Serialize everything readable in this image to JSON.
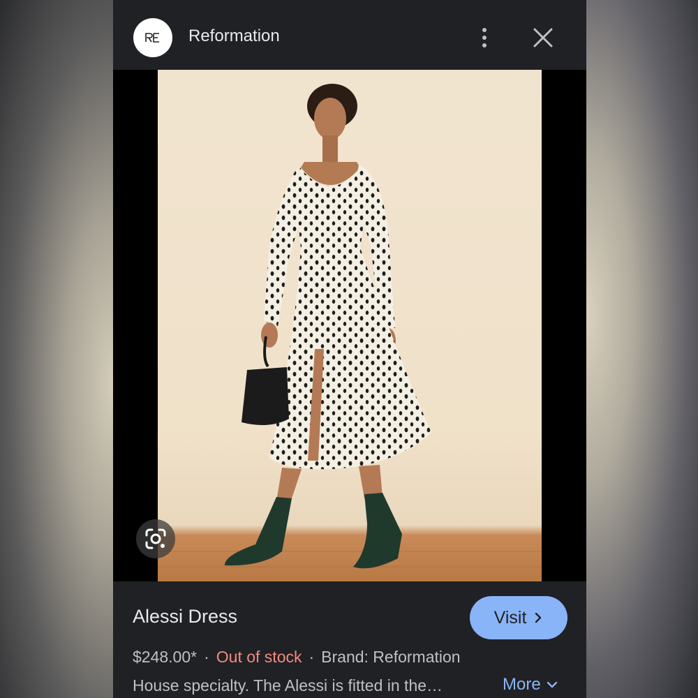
{
  "header": {
    "site_name": "Reformation",
    "logo_icon": "reformation-logo-icon",
    "menu_icon": "more-vert-icon",
    "close_icon": "close-icon"
  },
  "image": {
    "lens_icon": "google-lens-icon"
  },
  "product": {
    "title": "Alessi Dress",
    "price": "$248.00*",
    "separator": "·",
    "stock_status": "Out of stock",
    "brand": "Brand: Reformation",
    "description": "House specialty. The Alessi is fitted in the…",
    "more_label": "More"
  },
  "actions": {
    "visit_label": "Visit"
  },
  "colors": {
    "panel_bg": "#202124",
    "accent": "#8ab4f8",
    "stock_status": "#f28b82"
  }
}
